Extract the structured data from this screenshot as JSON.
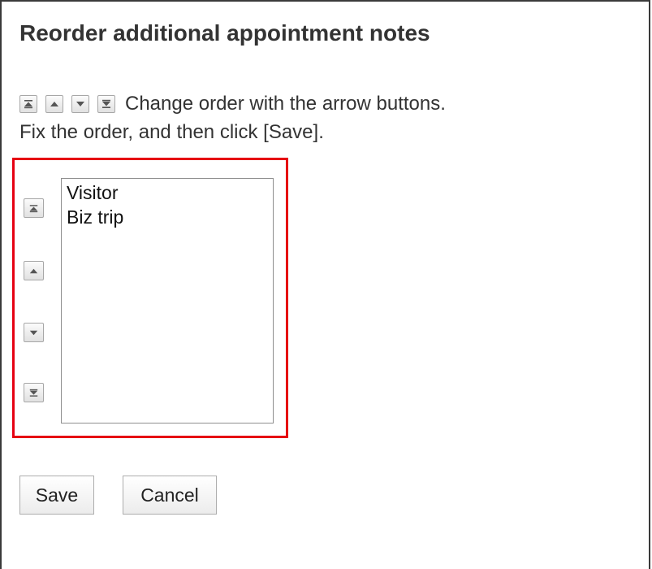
{
  "page": {
    "title": "Reorder additional appointment notes"
  },
  "instructions": {
    "line1": "Change order with the arrow buttons.",
    "line2": "Fix the order, and then click [Save].",
    "icons": [
      "move-to-top-icon",
      "move-up-icon",
      "move-down-icon",
      "move-to-bottom-icon"
    ]
  },
  "order_list": {
    "items": [
      "Visitor",
      "Biz trip"
    ]
  },
  "side_buttons": {
    "icons": [
      "move-to-top-icon",
      "move-up-icon",
      "move-down-icon",
      "move-to-bottom-icon"
    ]
  },
  "actions": {
    "save_label": "Save",
    "cancel_label": "Cancel"
  },
  "colors": {
    "highlight_border": "#e60012",
    "text": "#333333",
    "button_border": "#a7a7a7"
  }
}
